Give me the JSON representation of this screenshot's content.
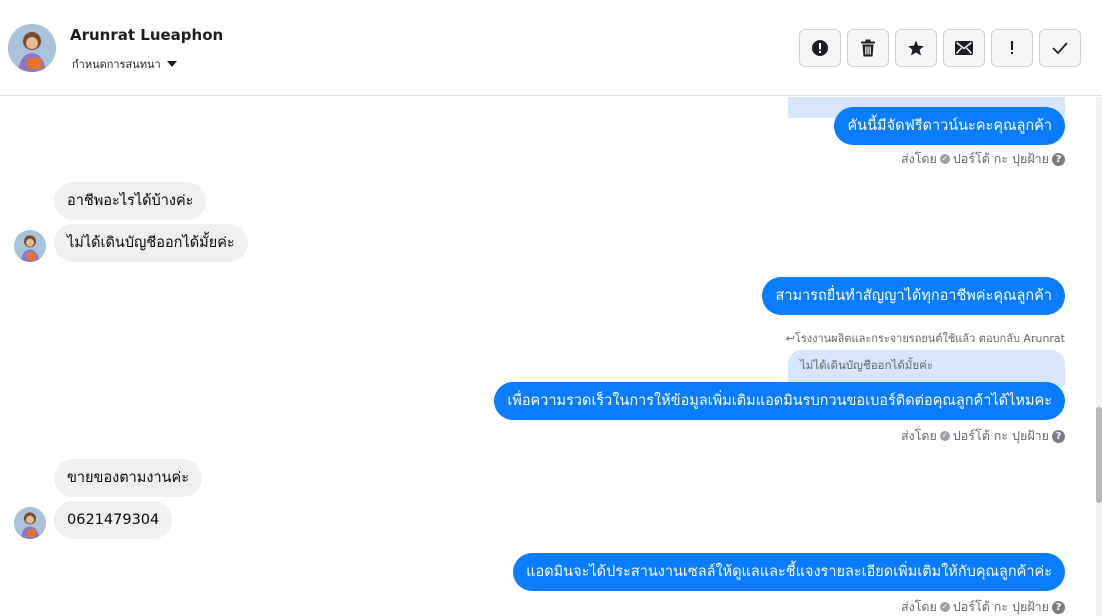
{
  "header": {
    "contact_name": "Arunrat Lueaphon",
    "label_dropdown": "กำหนดการสนทนา",
    "actions": [
      {
        "name": "mark-spam-button",
        "icon": "alert-circle-icon"
      },
      {
        "name": "delete-button",
        "icon": "trash-icon"
      },
      {
        "name": "star-button",
        "icon": "star-icon"
      },
      {
        "name": "mark-unread-button",
        "icon": "envelope-icon"
      },
      {
        "name": "follow-up-button",
        "icon": "exclamation-icon"
      },
      {
        "name": "mark-done-button",
        "icon": "checkmark-icon"
      }
    ]
  },
  "messages": {
    "m1_out": "คันนี้มีจัดฟรีดาวน์นะคะคุณลูกค้า",
    "m1_meta_prefix": "ส่งโดย",
    "m1_meta_sender": "ปอร์โต้ กะ ปุยฝ้าย",
    "m2_in": "อาชีพอะไรได้บ้างค่ะ",
    "m3_in": "ไม่ได้เดินบัญชีออกได้มั้ยค่ะ",
    "m4_out": "สามารถยื่นทำสัญญาได้ทุกอาชีพค่ะคุณลูกค้า",
    "m5_reply_note": "โรงงานผลิตและกระจายรถยนต์ใช้แล้ว ตอบกลับ Arunrat",
    "m5_quote": "ไม่ได้เดินบัญชีออกได้มั้ยค่ะ",
    "m5_out": "เพื่อความรวดเร็วในการให้ข้อมูลเพิ่มเติมแอดมินรบกวนขอเบอร์ติดต่อคุณลูกค้าได้ไหมคะ",
    "m5_meta_prefix": "ส่งโดย",
    "m5_meta_sender": "ปอร์โต้ กะ ปุยฝ้าย",
    "m6_in": "ขายของตามงานค่ะ",
    "m7_in": "0621479304",
    "m8_out": "แอดมินจะได้ประสานงานเซลล์ให้ดูแลและชี้แจงรายละเอียดเพิ่มเติมให้กับคุณลูกค้าค่ะ",
    "m8_meta_prefix": "ส่งโดย",
    "m8_meta_sender": "ปอร์โต้ กะ ปุยฝ้าย",
    "help_glyph": "?"
  },
  "colors": {
    "outgoing_bubble": "#0a7cff",
    "incoming_bubble": "#f0f0f0",
    "quote_bubble": "#d7e6fc"
  }
}
